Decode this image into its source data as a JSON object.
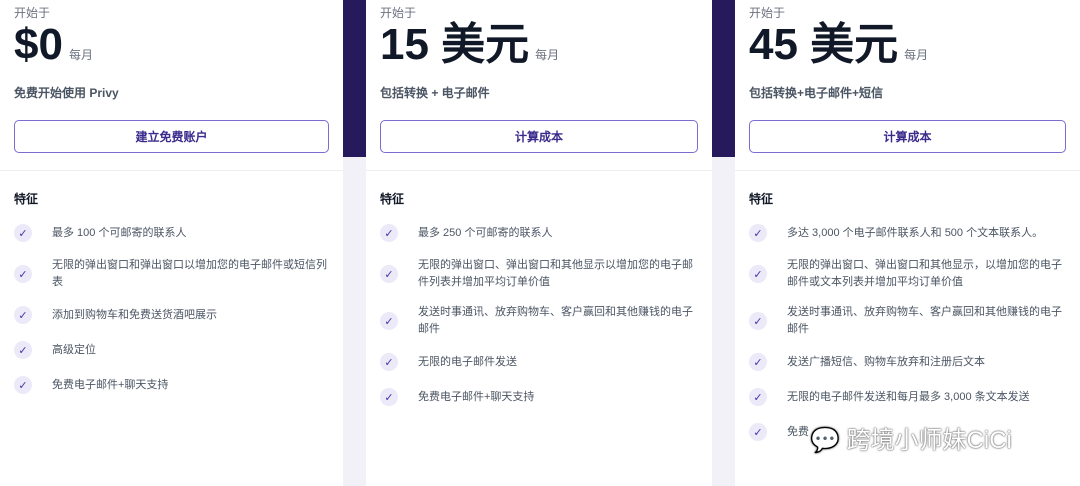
{
  "plans": [
    {
      "starts": "开始于",
      "price": "$0",
      "per": "每月",
      "desc": "免费开始使用 Privy",
      "button": "建立免费账户",
      "features_title": "特征",
      "features": [
        "最多 100 个可邮寄的联系人",
        "无限的弹出窗口和弹出窗口以增加您的电子邮件或短信列表",
        "添加到购物车和免费送货酒吧展示",
        "高级定位",
        "免费电子邮件+聊天支持"
      ]
    },
    {
      "starts": "开始于",
      "price": "15 美元",
      "per": "每月",
      "desc": "包括转换 + 电子邮件",
      "button": "计算成本",
      "features_title": "特征",
      "features": [
        "最多 250 个可邮寄的联系人",
        "无限的弹出窗口、弹出窗口和其他显示以增加您的电子邮件列表并增加平均订单价值",
        "发送时事通讯、放弃购物车、客户赢回和其他赚钱的电子邮件",
        "无限的电子邮件发送",
        "免费电子邮件+聊天支持"
      ]
    },
    {
      "starts": "开始于",
      "price": "45 美元",
      "per": "每月",
      "desc": "包括转换+电子邮件+短信",
      "button": "计算成本",
      "features_title": "特征",
      "features": [
        "多达 3,000 个电子邮件联系人和 500 个文本联系人。",
        "无限的弹出窗口、弹出窗口和其他显示，以增加您的电子邮件或文本列表并增加平均订单价值",
        "发送时事通讯、放弃购物车、客户赢回和其他赚钱的电子邮件",
        "发送广播短信、购物车放弃和注册后文本",
        "无限的电子邮件发送和每月最多 3,000 条文本发送",
        "免费"
      ]
    }
  ],
  "watermark": "跨境小师妹CiCi"
}
